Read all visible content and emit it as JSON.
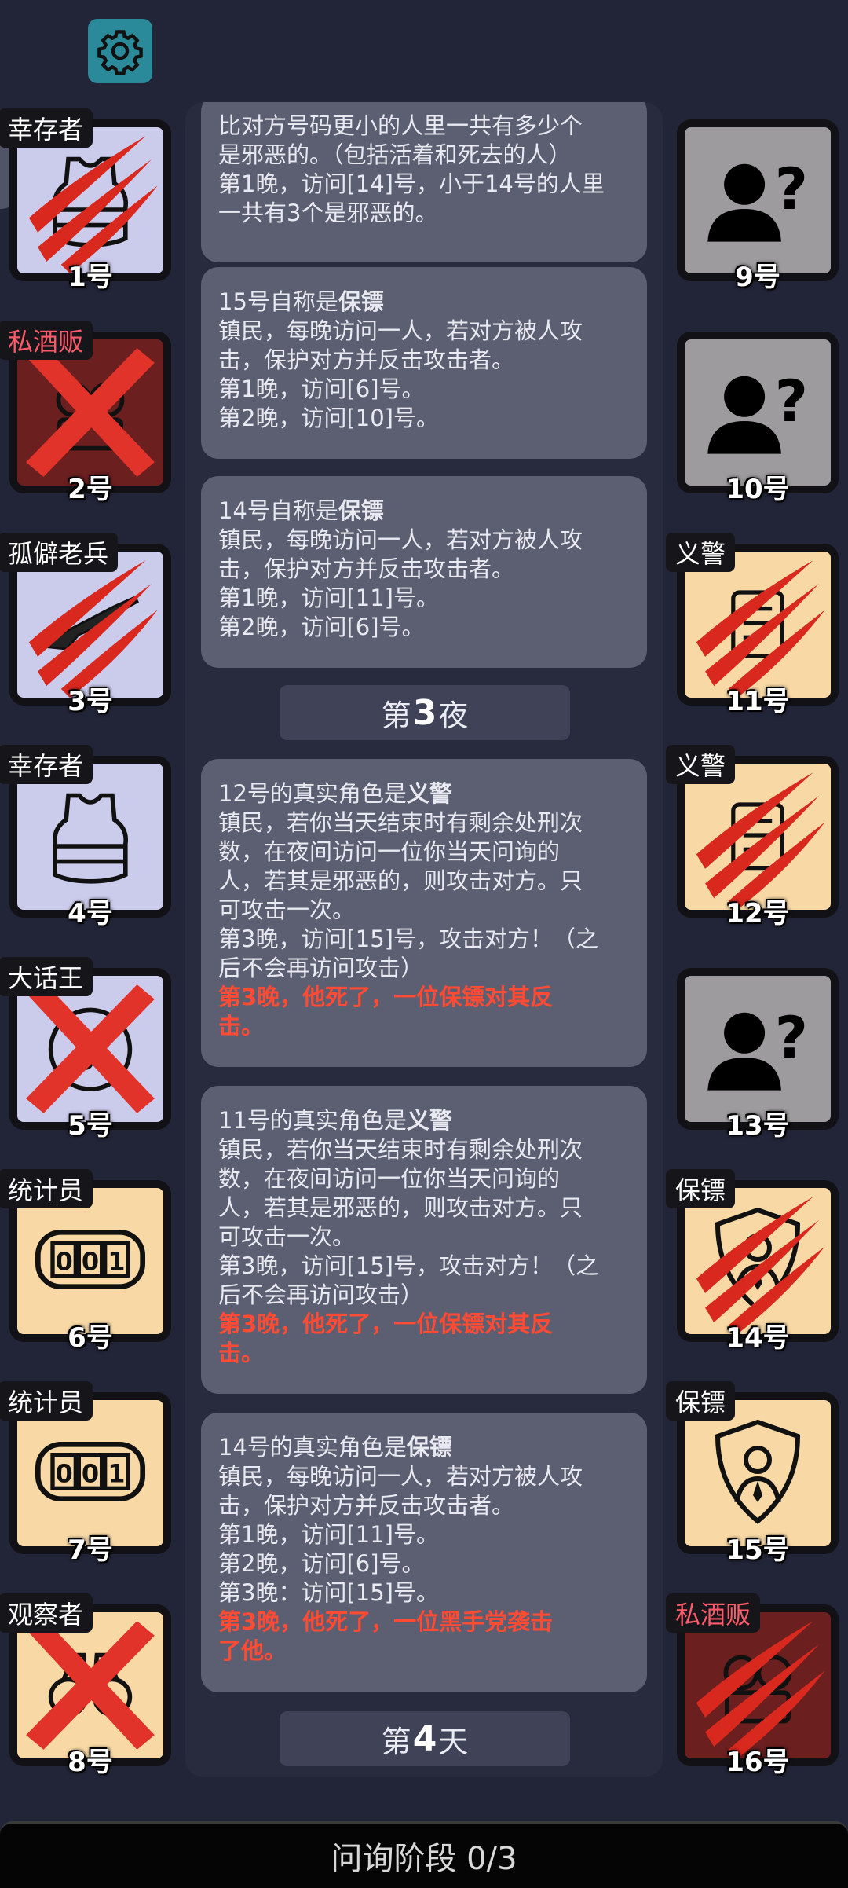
{
  "messages": [
    {
      "lines": [
        {
          "text": "比对方号码更小的人里一共有多少个",
          "style": "normal"
        },
        {
          "text": "是邪恶的。（包括活着和死去的人）",
          "style": "normal"
        },
        {
          "text": "第1晚，访问[14]号，小于14号的人里",
          "style": "normal"
        },
        {
          "text": "一共有3个是邪恶的。",
          "style": "normal"
        }
      ]
    },
    {
      "lines": [
        {
          "text": "15号自称是",
          "emph": "保镖",
          "style": "normal"
        },
        {
          "text": "镇民，每晚访问一人，若对方被人攻",
          "style": "normal"
        },
        {
          "text": "击，保护对方并反击攻击者。",
          "style": "normal"
        },
        {
          "text": "第1晚，访问[6]号。",
          "style": "normal"
        },
        {
          "text": "第2晚，访问[10]号。",
          "style": "normal"
        }
      ]
    },
    {
      "lines": [
        {
          "text": "14号自称是",
          "emph": "保镖",
          "style": "normal"
        },
        {
          "text": "镇民，每晚访问一人，若对方被人攻",
          "style": "normal"
        },
        {
          "text": "击，保护对方并反击攻击者。",
          "style": "normal"
        },
        {
          "text": "第1晚，访问[11]号。",
          "style": "normal"
        },
        {
          "text": "第2晚，访问[6]号。",
          "style": "normal"
        }
      ]
    },
    {
      "lines": [
        {
          "text": "12号的真实角色是",
          "emph": "义警",
          "style": "normal"
        },
        {
          "text": "镇民，若你当天结束时有剩余处刑次",
          "style": "normal"
        },
        {
          "text": "数，在夜间访问一位你当天问询的",
          "style": "normal"
        },
        {
          "text": "人，若其是邪恶的，则攻击对方。只",
          "style": "normal"
        },
        {
          "text": "可攻击一次。",
          "style": "normal"
        },
        {
          "text": "第3晚，访问[15]号，攻击对方！（之",
          "style": "normal"
        },
        {
          "text": "后不会再访问攻击）",
          "style": "normal"
        },
        {
          "text": "第3晚，他死了，一位保镖对其反",
          "style": "red"
        },
        {
          "text": "击。",
          "style": "red"
        }
      ]
    },
    {
      "lines": [
        {
          "text": "11号的真实角色是",
          "emph": "义警",
          "style": "normal"
        },
        {
          "text": "镇民，若你当天结束时有剩余处刑次",
          "style": "normal"
        },
        {
          "text": "数，在夜间访问一位你当天问询的",
          "style": "normal"
        },
        {
          "text": "人，若其是邪恶的，则攻击对方。只",
          "style": "normal"
        },
        {
          "text": "可攻击一次。",
          "style": "normal"
        },
        {
          "text": "第3晚，访问[15]号，攻击对方！（之",
          "style": "normal"
        },
        {
          "text": "后不会再访问攻击）",
          "style": "normal"
        },
        {
          "text": "第3晚，他死了，一位保镖对其反",
          "style": "red"
        },
        {
          "text": "击。",
          "style": "red"
        }
      ]
    },
    {
      "lines": [
        {
          "text": "14号的真实角色是",
          "emph": "保镖",
          "style": "normal"
        },
        {
          "text": "镇民，每晚访问一人，若对方被人攻",
          "style": "normal"
        },
        {
          "text": "击，保护对方并反击攻击者。",
          "style": "normal"
        },
        {
          "text": "第1晚，访问[11]号。",
          "style": "normal"
        },
        {
          "text": "第2晚，访问[6]号。",
          "style": "normal"
        },
        {
          "text": "第3晚：访问[15]号。",
          "style": "normal"
        },
        {
          "text": "第3晚，他死了，一位黑手党袭击",
          "style": "red"
        },
        {
          "text": "了他。",
          "style": "red"
        }
      ]
    }
  ],
  "separators": {
    "night3": {
      "pre": "第",
      "num": "3",
      "post": "夜"
    },
    "day4": {
      "pre": "第",
      "num": "4",
      "post": "天"
    }
  },
  "players": [
    {
      "num": "1号",
      "role": "幸存者",
      "role_color": "white",
      "bg": "purple",
      "icon": "vest-icon",
      "status": "clawed"
    },
    {
      "num": "2号",
      "role": "私酒贩",
      "role_color": "red",
      "bg": "darkred",
      "icon": "bootlegger-icon",
      "status": "executed"
    },
    {
      "num": "3号",
      "role": "孤僻老兵",
      "role_color": "white",
      "bg": "purple",
      "icon": "rifle-icon",
      "status": "clawed"
    },
    {
      "num": "4号",
      "role": "幸存者",
      "role_color": "white",
      "bg": "purple",
      "icon": "vest-icon",
      "status": "alive"
    },
    {
      "num": "5号",
      "role": "大话王",
      "role_color": "white",
      "bg": "purple",
      "icon": "pizza-icon",
      "status": "executed"
    },
    {
      "num": "6号",
      "role": "统计员",
      "role_color": "white",
      "bg": "cream",
      "icon": "counter-icon",
      "status": "alive"
    },
    {
      "num": "7号",
      "role": "统计员",
      "role_color": "white",
      "bg": "cream",
      "icon": "counter-icon",
      "status": "alive"
    },
    {
      "num": "8号",
      "role": "观察者",
      "role_color": "white",
      "bg": "cream",
      "icon": "binoculars-icon",
      "status": "executed"
    },
    {
      "num": "9号",
      "role": "",
      "role_color": "white",
      "bg": "gray",
      "icon": "unknown-person-icon",
      "status": "alive"
    },
    {
      "num": "10号",
      "role": "",
      "role_color": "white",
      "bg": "gray",
      "icon": "unknown-person-icon",
      "status": "alive"
    },
    {
      "num": "11号",
      "role": "义警",
      "role_color": "white",
      "bg": "cream",
      "icon": "vigilante-icon",
      "status": "clawed"
    },
    {
      "num": "12号",
      "role": "义警",
      "role_color": "white",
      "bg": "cream",
      "icon": "vigilante-icon",
      "status": "clawed"
    },
    {
      "num": "13号",
      "role": "",
      "role_color": "white",
      "bg": "gray",
      "icon": "unknown-person-icon",
      "status": "alive"
    },
    {
      "num": "14号",
      "role": "保镖",
      "role_color": "white",
      "bg": "cream",
      "icon": "shield-person-icon",
      "status": "clawed"
    },
    {
      "num": "15号",
      "role": "保镖",
      "role_color": "white",
      "bg": "cream",
      "icon": "shield-person-icon",
      "status": "alive"
    },
    {
      "num": "16号",
      "role": "私酒贩",
      "role_color": "red",
      "bg": "darkred",
      "icon": "bootlegger-icon",
      "status": "clawed"
    }
  ],
  "bottom_bar": {
    "label": "问询阶段 0/3"
  },
  "colors": {
    "background": "#222538",
    "bubble": "#5c5f72",
    "death_text": "#ff4a34",
    "claw": "#d9291f"
  }
}
